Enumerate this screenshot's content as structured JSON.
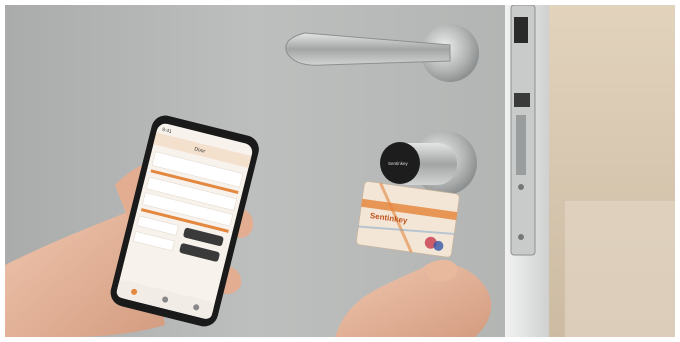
{
  "scene": {
    "kind": "photo",
    "palette": {
      "door": "#b9bbba",
      "door_dark": "#9ea1a1",
      "steel": "#c8c9c9",
      "card_orange": "#e4873f",
      "phone_black": "#1a1a1a",
      "wall_beige": "#d8c7b0",
      "skin": "#e7b79c"
    }
  },
  "phone": {
    "status_time": "9:41",
    "title": "Door",
    "rows": [
      "",
      "",
      "",
      "",
      ""
    ]
  },
  "card": {
    "brand": "Sentinkey"
  },
  "cylinder": {
    "brand": "Sentinkey"
  }
}
